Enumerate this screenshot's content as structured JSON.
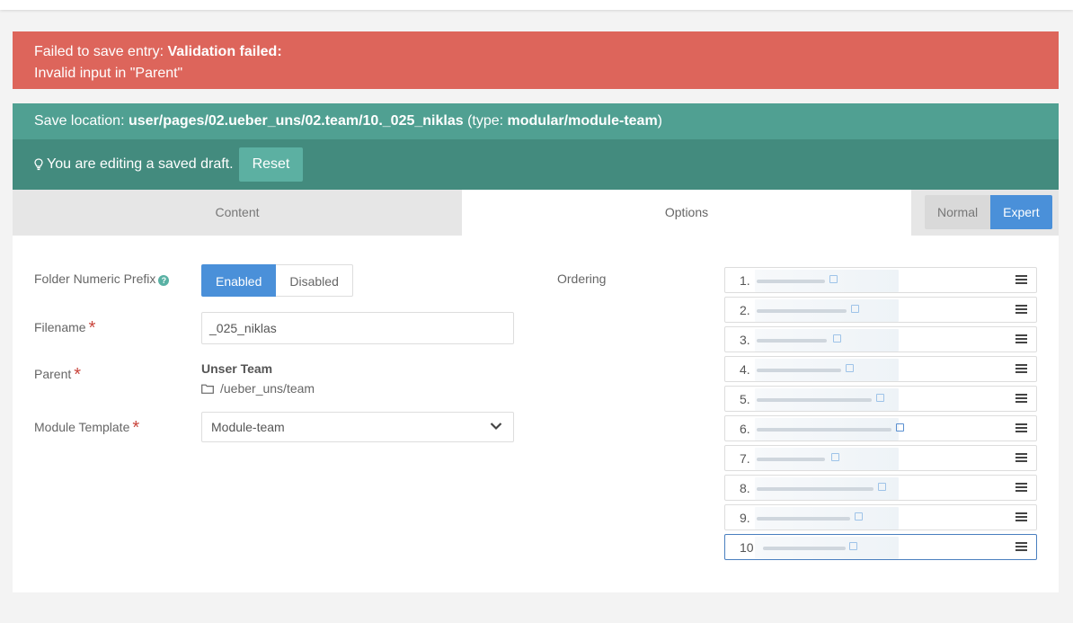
{
  "alert": {
    "prefix": "Failed to save entry: ",
    "title": "Validation failed:",
    "message": "Invalid input in \"Parent\""
  },
  "save_location": {
    "label": "Save location: ",
    "path": "user/pages/02.ueber_uns/02.team/10._025_niklas",
    "type_open": " (type: ",
    "type": "modular/module-team",
    "type_close": ")"
  },
  "draft": {
    "message": "You are editing a saved draft.",
    "reset_label": "Reset"
  },
  "tabs": {
    "content": "Content",
    "options": "Options"
  },
  "mode": {
    "normal": "Normal",
    "expert": "Expert"
  },
  "form": {
    "folder_prefix_label": "Folder Numeric Prefix",
    "enabled": "Enabled",
    "disabled": "Disabled",
    "filename_label": "Filename",
    "filename_value": "_025_niklas",
    "parent_label": "Parent",
    "parent_title": "Unser Team",
    "parent_path": "/ueber_uns/team",
    "module_template_label": "Module Template",
    "module_template_value": "Module-team",
    "required_mark": "*"
  },
  "ordering": {
    "label": "Ordering",
    "items": [
      "1.",
      "2.",
      "3.",
      "4.",
      "5.",
      "6.",
      "7.",
      "8.",
      "9.",
      "10"
    ],
    "active_index": 9
  },
  "colors": {
    "error": "#dd655b",
    "save_location": "#50a092",
    "draft": "#438b7e",
    "accent": "#4a90d9"
  }
}
